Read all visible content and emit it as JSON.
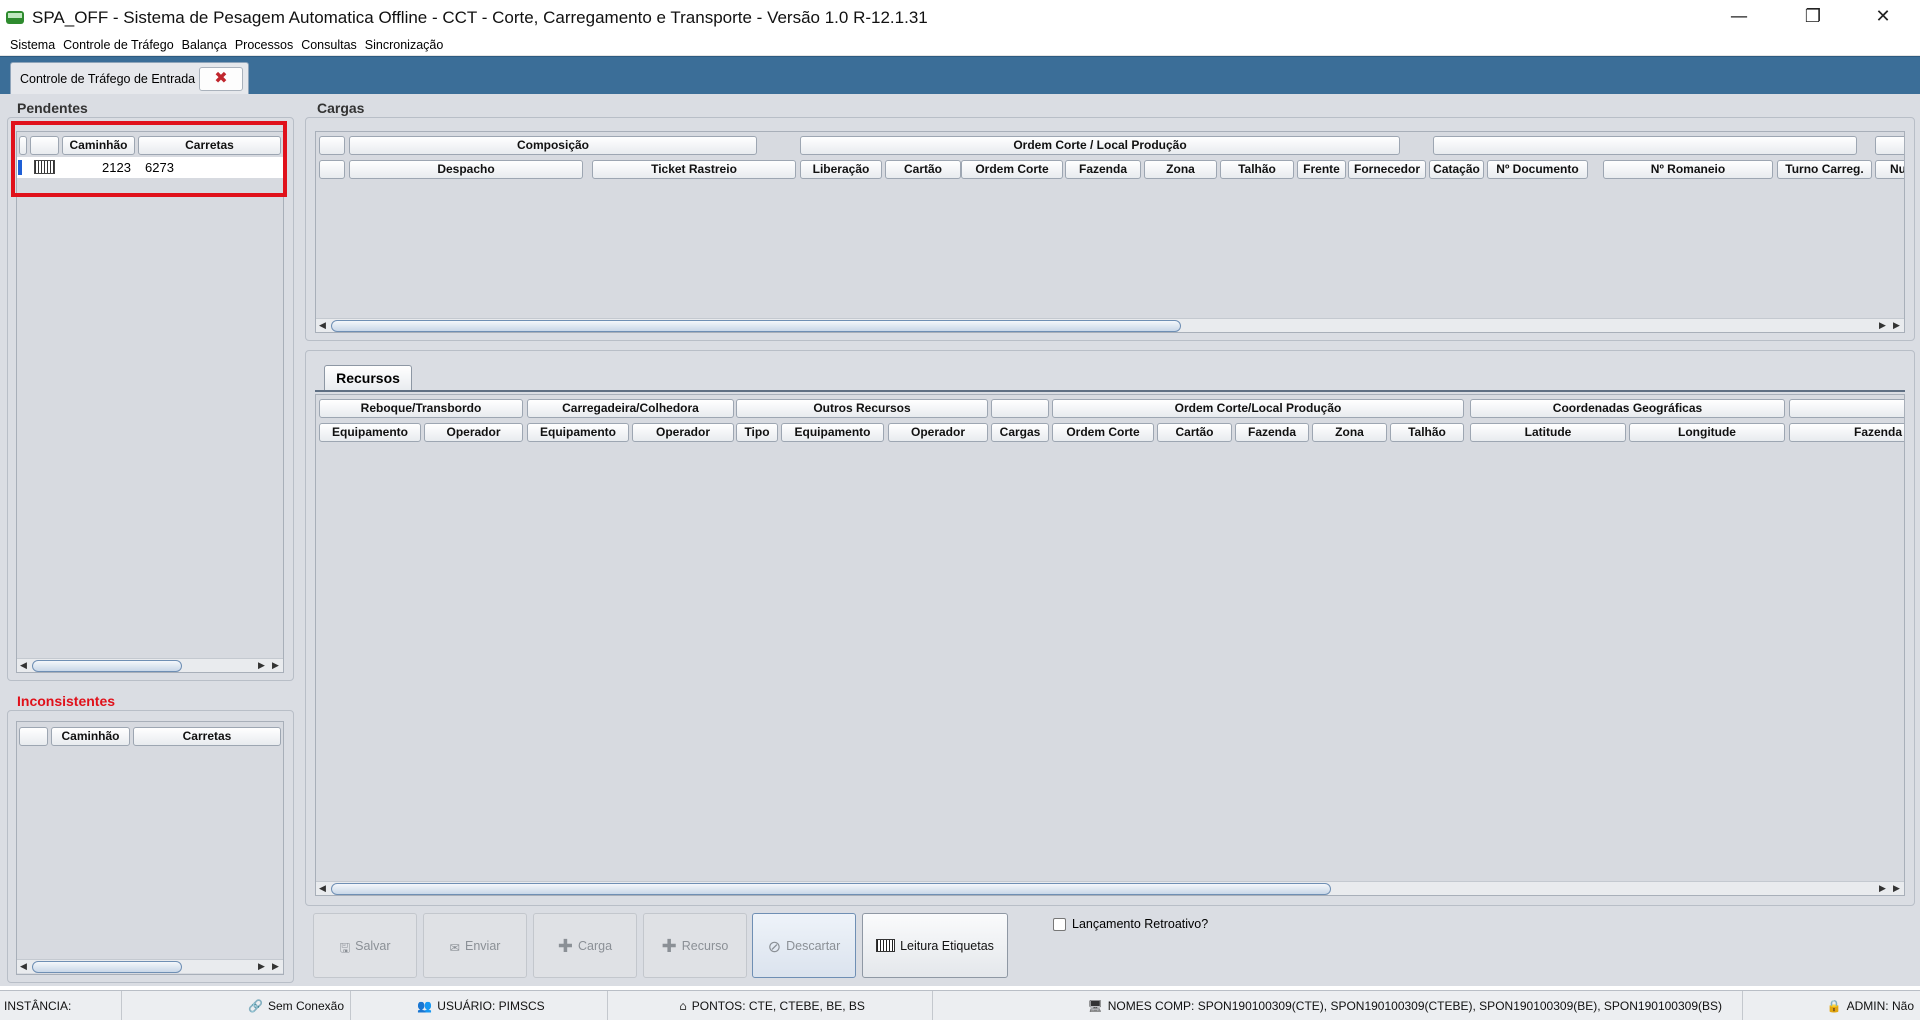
{
  "window": {
    "title": "SPA_OFF - Sistema de Pesagem Automatica Offline - CCT - Corte, Carregamento e Transporte - Versão 1.0 R-12.1.31",
    "minimize_glyph": "—",
    "maximize_glyph": "❐",
    "close_glyph": "✕"
  },
  "menu": [
    "Sistema",
    "Controle de Tráfego",
    "Balança",
    "Processos",
    "Consultas",
    "Sincronização"
  ],
  "tab": {
    "label": "Controle de Tráfego de Entrada",
    "close_glyph": "✖"
  },
  "pendentes": {
    "title": "Pendentes",
    "headers": [
      "",
      "Caminhão",
      "Carretas"
    ],
    "rows": [
      {
        "caminhao": "2123",
        "carretas": "6273"
      }
    ]
  },
  "inconsistentes": {
    "title": "Inconsistentes",
    "headers": [
      "",
      "Caminhão",
      "Carretas"
    ]
  },
  "cargas": {
    "title": "Cargas",
    "group_headers": [
      "",
      "Composição",
      "Ordem Corte / Local Produção",
      "",
      ""
    ],
    "headers": [
      "",
      "Despacho",
      "Ticket Rastreio",
      "Liberação",
      "Cartão",
      "Ordem Corte",
      "Fazenda",
      "Zona",
      "Talhão",
      "Frente",
      "Fornecedor",
      "Catação",
      "Nº Documento",
      "Nº Romaneio",
      "Turno Carreg.",
      "Nu"
    ]
  },
  "recursos": {
    "tab_label": "Recursos",
    "group_headers": [
      "Reboque/Transbordo",
      "Carregadeira/Colhedora",
      "Outros Recursos",
      "",
      "Ordem Corte/Local Produção",
      "Coordenadas Geográficas",
      ""
    ],
    "headers": [
      "Equipamento",
      "Operador",
      "Equipamento",
      "Operador",
      "Tipo",
      "Equipamento",
      "Operador",
      "Cargas",
      "Ordem Corte",
      "Cartão",
      "Fazenda",
      "Zona",
      "Talhão",
      "Latitude",
      "Longitude",
      "Fazenda"
    ]
  },
  "toolbar": {
    "salvar": "Salvar",
    "enviar": "Enviar",
    "carga": "Carga",
    "recurso": "Recurso",
    "descartar": "Descartar",
    "leitura": "Leitura Etiquetas",
    "retroativo": "Lançamento Retroativo?"
  },
  "status": {
    "instancia": "INSTÂNCIA:",
    "conexao": "Sem Conexão",
    "usuario": "USUÁRIO: PIMSCS",
    "pontos": "PONTOS: CTE, CTEBE, BE, BS",
    "nomes": "NOMES COMP: SPON190100309(CTE), SPON190100309(CTEBE), SPON190100309(BE), SPON190100309(BS)",
    "admin": "ADMIN: Não"
  },
  "colors": {
    "tabstrip": "#3b6e98",
    "workspace": "#dadde3",
    "highlight": "#e0111b",
    "warning_title": "#e0111b",
    "row_marker": "#1e5fd6"
  }
}
